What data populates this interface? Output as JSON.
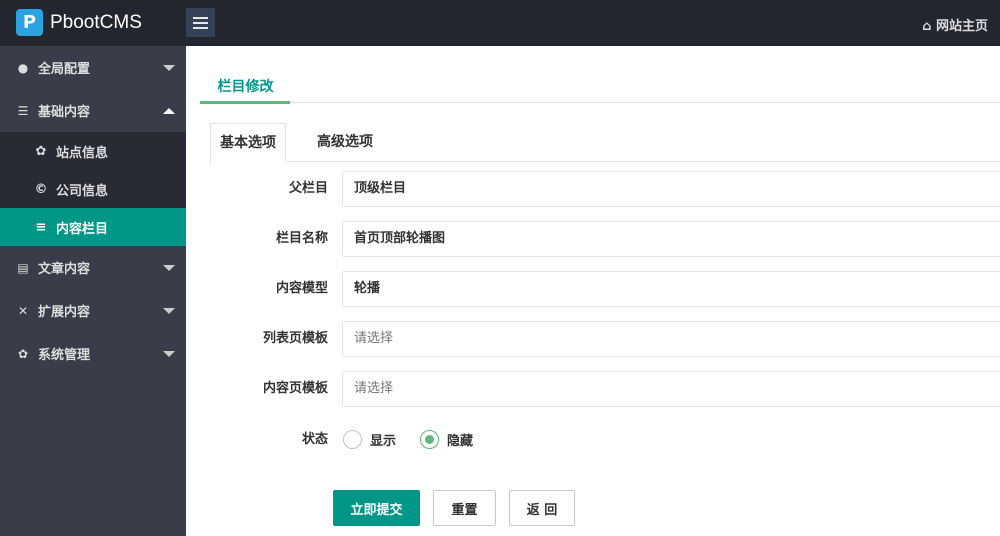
{
  "header": {
    "logo_text": "PbootCMS",
    "home_label": "网站主页"
  },
  "sidebar": {
    "items": [
      {
        "label": "全局配置",
        "icon": "globe-icon",
        "expanded": false
      },
      {
        "label": "基础内容",
        "icon": "sliders-icon",
        "expanded": true,
        "children": [
          {
            "label": "站点信息",
            "icon": "gear-icon"
          },
          {
            "label": "公司信息",
            "icon": "copyright-icon"
          },
          {
            "label": "内容栏目",
            "icon": "list-icon",
            "active": true
          }
        ]
      },
      {
        "label": "文章内容",
        "icon": "file-icon",
        "expanded": false
      },
      {
        "label": "扩展内容",
        "icon": "expand-icon",
        "expanded": false
      },
      {
        "label": "系统管理",
        "icon": "gear-icon",
        "expanded": false
      }
    ]
  },
  "main": {
    "page_tab": "栏目修改",
    "tabs": [
      "基本选项",
      "高级选项"
    ],
    "form": {
      "parent": {
        "label": "父栏目",
        "value": "顶级栏目"
      },
      "name": {
        "label": "栏目名称",
        "value": "首页顶部轮播图"
      },
      "model": {
        "label": "内容模型",
        "value": "轮播"
      },
      "list_tpl": {
        "label": "列表页模板",
        "placeholder": "请选择"
      },
      "content_tpl": {
        "label": "内容页模板",
        "placeholder": "请选择"
      },
      "status": {
        "label": "状态",
        "options": [
          "显示",
          "隐藏"
        ],
        "selected": "隐藏"
      }
    },
    "buttons": {
      "submit": "立即提交",
      "reset": "重置",
      "back": "返 回"
    }
  },
  "colors": {
    "accent": "#009688",
    "header": "#23262e",
    "sidebar": "#393d49",
    "radio": "#5fb878"
  }
}
